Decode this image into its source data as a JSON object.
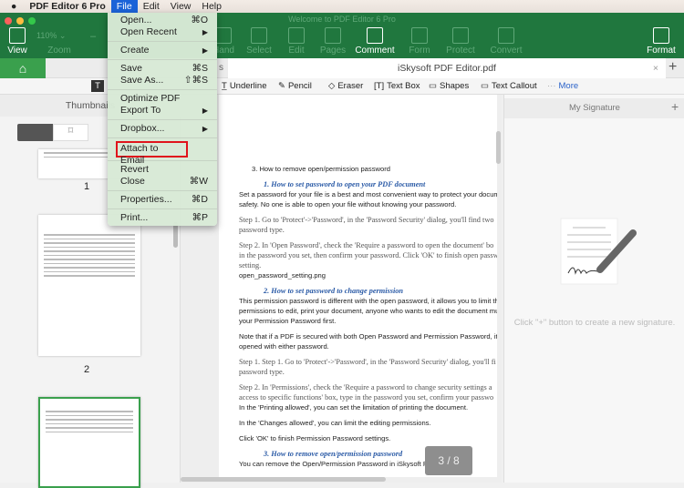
{
  "menubar": {
    "app": "PDF Editor 6 Pro",
    "items": [
      "File",
      "Edit",
      "View",
      "Help"
    ]
  },
  "window_title": "Welcome to PDF Editor 6 Pro",
  "toolbar": {
    "view": "View",
    "zoom_value": "110%",
    "zoom": "Zoom",
    "hand": "Hand",
    "select": "Select",
    "edit": "Edit",
    "pages": "Pages",
    "comment": "Comment",
    "form": "Form",
    "protect": "Protect",
    "convert": "Convert",
    "format": "Format"
  },
  "tabs": {
    "home_icon": "home-icon",
    "doc_tab": "iSkysoft PDF Editor.pdf",
    "partial": "s"
  },
  "comment_tools": [
    "Underline",
    "Pencil",
    "Eraser",
    "Text Box",
    "Shapes",
    "Text Callout",
    "More"
  ],
  "sidebar": {
    "title": "Thumbnails",
    "pages": [
      "1",
      "2"
    ]
  },
  "file_menu": [
    {
      "label": "Open...",
      "shortcut": "⌘O"
    },
    {
      "label": "Open Recent",
      "shortcut": "▶"
    },
    {
      "label": "Create",
      "shortcut": "▶"
    },
    {
      "label": "Save",
      "shortcut": "⌘S"
    },
    {
      "label": "Save As...",
      "shortcut": "⇧⌘S"
    },
    {
      "label": "Optimize PDF",
      "shortcut": ""
    },
    {
      "label": "Export To",
      "shortcut": "▶"
    },
    {
      "label": "Dropbox...",
      "shortcut": "▶"
    },
    {
      "label": "Attach to Email",
      "shortcut": ""
    },
    {
      "label": "Revert",
      "shortcut": ""
    },
    {
      "label": "Close",
      "shortcut": "⌘W"
    },
    {
      "label": "Properties...",
      "shortcut": "⌘D"
    },
    {
      "label": "Print...",
      "shortcut": "⌘P"
    }
  ],
  "document": {
    "lines": [
      "3.    How to remove open/permission password",
      "1.          How to set password to open your PDF document",
      "Set a password for your file is a best and most convenient way to protect your documer",
      "safety. No one is able to open your file without knowing your password.",
      "Step 1. Go to 'Protect'->'Password', in the 'Password Security' dialog, you'll find two",
      "password type.",
      "Step 2. In 'Open Password', check the 'Require a password to open the document' bo",
      "in the password you set, then confirm your password. Click 'OK' to finish open passw",
      "setting.",
      "open_password_setting.png",
      "2.          How to set password to change permission",
      "This permission password is different with the open password, it allows you to limit the",
      "permissions to edit, print your document, anyone who wants to edit the document mus",
      "your Permission Password first.",
      "Note that if a PDF is secured with both Open Password and Permission Password, it can",
      "opened with either password.",
      "Step 1. Step 1. Go to 'Protect'->'Password', in the 'Password Security' dialog, you'll fi",
      "password type.",
      "Step 2. In 'Permissions', check the 'Require a password to change security settings a",
      "access to specific functions' box, type in the password you set, confirm your passwo",
      "In the 'Printing allowed', you can set the limitation of printing the document.",
      "In the 'Changes allowed', you can limit the editing permissions.",
      "Click 'OK' to finish Permission Password settings.",
      "3.          How to remove open/permission password",
      "You can remove the Open/Permission Password in iSkysoft PDF Editor."
    ],
    "page_indicator": "3 / 8"
  },
  "signature": {
    "title": "My Signature",
    "add": "+",
    "hint": "Click \"+\" button to create a new signature."
  },
  "colors": {
    "toolbar": "#20773e",
    "home_tab": "#3aa04d",
    "menu_highlight": "#1b63d8",
    "callout": "#e0141c",
    "heading": "#2a5aa6"
  }
}
